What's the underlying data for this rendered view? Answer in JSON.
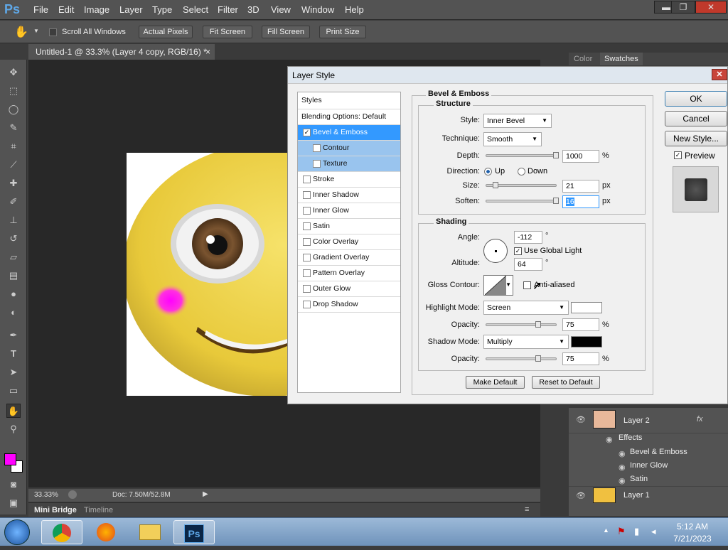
{
  "menubar": {
    "logo": "Ps",
    "items": [
      "File",
      "Edit",
      "Image",
      "Layer",
      "Type",
      "Select",
      "Filter",
      "3D",
      "View",
      "Window",
      "Help"
    ],
    "minimize": "▬",
    "restore": "❐",
    "close": "✕"
  },
  "options": {
    "scroll_all_windows": "Scroll All Windows",
    "actual_pixels": "Actual Pixels",
    "fit_screen": "Fit Screen",
    "fill_screen": "Fill Screen",
    "print_size": "Print Size"
  },
  "document": {
    "tab_title": "Untitled-1 @ 33.3% (Layer 4 copy, RGB/16) *",
    "tab_close": "×"
  },
  "status": {
    "zoom": "33.33%",
    "doc": "Doc: 7.50M/52.8M"
  },
  "bottom_tabs": [
    "Mini Bridge",
    "Timeline"
  ],
  "right_panel": {
    "tabs": [
      "Color",
      "Swatches"
    ]
  },
  "layers": {
    "layer2": "Layer 2",
    "effects": "Effects",
    "effect_items": [
      "Bevel & Emboss",
      "Inner Glow",
      "Satin"
    ],
    "layer1": "Layer 1",
    "fx": "fx"
  },
  "dialog": {
    "title": "Layer Style",
    "close": "✕",
    "styles_header": "Styles",
    "blending": "Blending Options: Default",
    "style_items": [
      {
        "label": "Bevel & Emboss",
        "checked": true
      },
      {
        "label": "Contour",
        "checked": false
      },
      {
        "label": "Texture",
        "checked": false
      },
      {
        "label": "Stroke",
        "checked": false
      },
      {
        "label": "Inner Shadow",
        "checked": false
      },
      {
        "label": "Inner Glow",
        "checked": false
      },
      {
        "label": "Satin",
        "checked": false
      },
      {
        "label": "Color Overlay",
        "checked": false
      },
      {
        "label": "Gradient Overlay",
        "checked": false
      },
      {
        "label": "Pattern Overlay",
        "checked": false
      },
      {
        "label": "Outer Glow",
        "checked": false
      },
      {
        "label": "Drop Shadow",
        "checked": false
      }
    ],
    "section_title": "Bevel & Emboss",
    "structure": {
      "title": "Structure",
      "style_label": "Style:",
      "style_value": "Inner Bevel",
      "technique_label": "Technique:",
      "technique_value": "Smooth",
      "depth_label": "Depth:",
      "depth_value": "1000",
      "depth_unit": "%",
      "direction_label": "Direction:",
      "dir_up": "Up",
      "dir_down": "Down",
      "size_label": "Size:",
      "size_value": "21",
      "size_unit": "px",
      "soften_label": "Soften:",
      "soften_value": "16",
      "soften_unit": "px"
    },
    "shading": {
      "title": "Shading",
      "angle_label": "Angle:",
      "angle_value": "-112",
      "angle_unit": "°",
      "global_light": "Use Global Light",
      "altitude_label": "Altitude:",
      "altitude_value": "64",
      "altitude_unit": "°",
      "gloss_label": "Gloss Contour:",
      "anti_aliased": "Anti-aliased",
      "highlight_label": "Highlight Mode:",
      "highlight_value": "Screen",
      "highlight_color": "#ffffff",
      "opacity_label": "Opacity:",
      "opacity1_value": "75",
      "opacity_unit": "%",
      "shadow_label": "Shadow Mode:",
      "shadow_value": "Multiply",
      "shadow_color": "#000000",
      "opacity2_value": "75"
    },
    "make_default": "Make Default",
    "reset_default": "Reset to Default",
    "ok": "OK",
    "cancel": "Cancel",
    "new_style": "New Style...",
    "preview": "Preview"
  },
  "taskbar": {
    "time": "5:12 AM",
    "date": "7/21/2023",
    "ps_label": "Ps"
  },
  "colors": {
    "foreground": "#ff00ff",
    "background": "#ffffff",
    "selection": "#3399ff"
  }
}
